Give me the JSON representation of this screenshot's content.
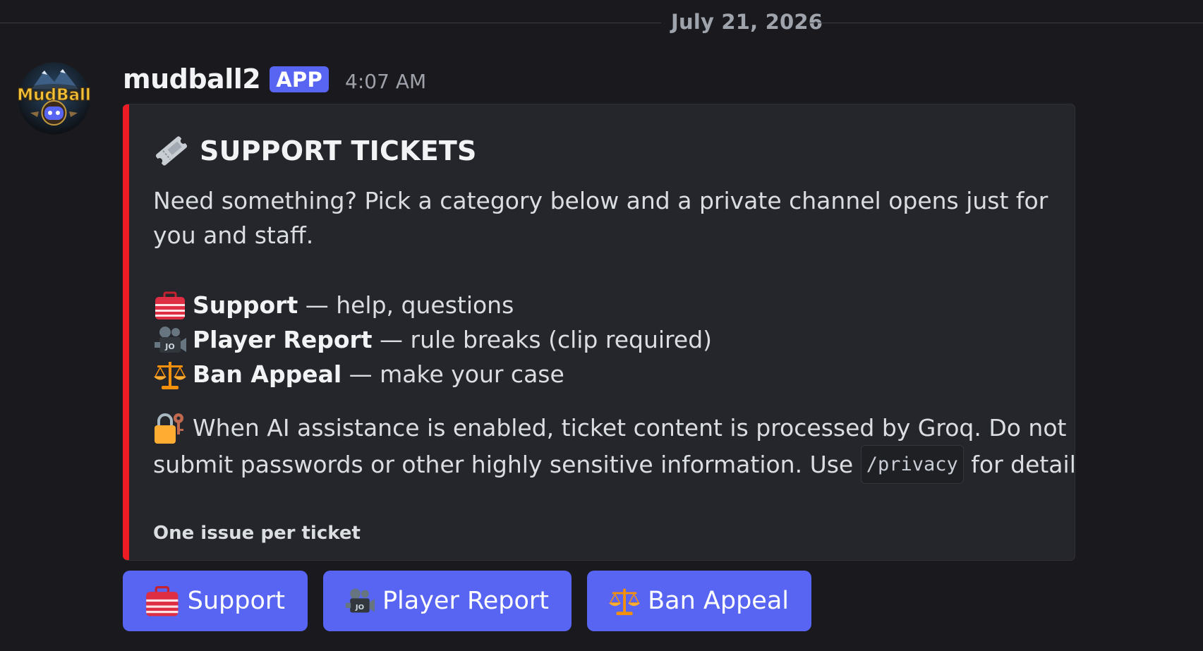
{
  "date_divider": "July 21, 2026",
  "message": {
    "username": "mudball2",
    "badge": "APP",
    "timestamp": "4:07 AM",
    "avatar_icon": "mudball-logo-avatar",
    "avatar_text": "MudBall"
  },
  "embed": {
    "accent_color": "#ed1c24",
    "title": "SUPPORT TICKETS",
    "intro_line1": "Need something? Pick a category below and a private channel opens just for",
    "intro_line2": "you and staff.",
    "items": [
      {
        "icon": "toolbox-icon",
        "label": "Support",
        "desc": " — help, questions"
      },
      {
        "icon": "movie-camera-icon",
        "label": "Player Report",
        "desc": " — rule breaks (clip required)"
      },
      {
        "icon": "scales-icon",
        "label": "Ban Appeal",
        "desc": " — make your case"
      }
    ],
    "notice_icon": "lock-key-icon",
    "notice_line1": "When AI assistance is enabled, ticket content is processed by Groq. Do not",
    "notice_line2_pre": "submit passwords or other highly sensitive information. Use ",
    "notice_code": "/privacy",
    "notice_line2_post": " for details.",
    "footer": "One issue per ticket"
  },
  "buttons": [
    {
      "icon": "toolbox-icon",
      "label": "Support"
    },
    {
      "icon": "movie-camera-icon",
      "label": "Player Report"
    },
    {
      "icon": "scales-icon",
      "label": "Ban Appeal"
    }
  ],
  "colors": {
    "background": "#1a1a1e",
    "embed_bg": "#25262b",
    "button": "#5865f2",
    "badge": "#5865f2"
  }
}
